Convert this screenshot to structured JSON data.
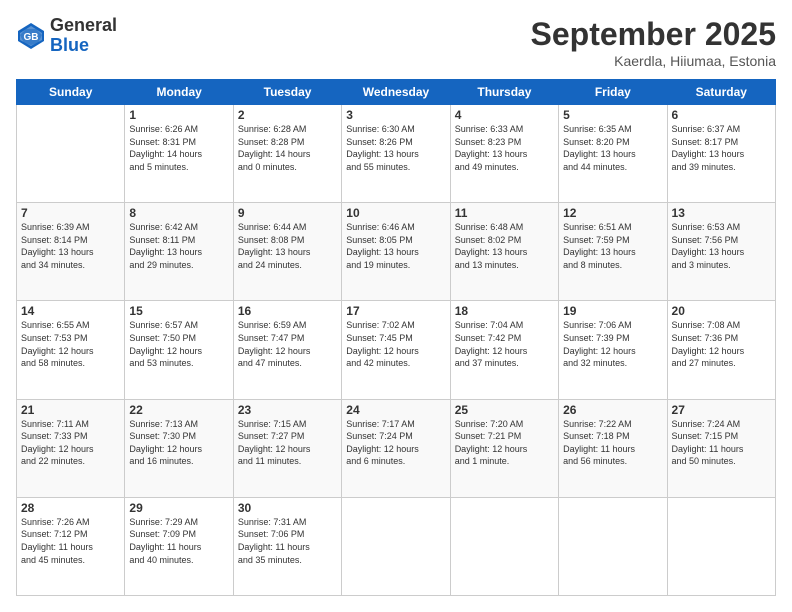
{
  "logo": {
    "general": "General",
    "blue": "Blue"
  },
  "header": {
    "month": "September 2025",
    "location": "Kaerdla, Hiiumaa, Estonia"
  },
  "weekdays": [
    "Sunday",
    "Monday",
    "Tuesday",
    "Wednesday",
    "Thursday",
    "Friday",
    "Saturday"
  ],
  "weeks": [
    [
      {
        "day": "",
        "info": ""
      },
      {
        "day": "1",
        "info": "Sunrise: 6:26 AM\nSunset: 8:31 PM\nDaylight: 14 hours\nand 5 minutes."
      },
      {
        "day": "2",
        "info": "Sunrise: 6:28 AM\nSunset: 8:28 PM\nDaylight: 14 hours\nand 0 minutes."
      },
      {
        "day": "3",
        "info": "Sunrise: 6:30 AM\nSunset: 8:26 PM\nDaylight: 13 hours\nand 55 minutes."
      },
      {
        "day": "4",
        "info": "Sunrise: 6:33 AM\nSunset: 8:23 PM\nDaylight: 13 hours\nand 49 minutes."
      },
      {
        "day": "5",
        "info": "Sunrise: 6:35 AM\nSunset: 8:20 PM\nDaylight: 13 hours\nand 44 minutes."
      },
      {
        "day": "6",
        "info": "Sunrise: 6:37 AM\nSunset: 8:17 PM\nDaylight: 13 hours\nand 39 minutes."
      }
    ],
    [
      {
        "day": "7",
        "info": "Sunrise: 6:39 AM\nSunset: 8:14 PM\nDaylight: 13 hours\nand 34 minutes."
      },
      {
        "day": "8",
        "info": "Sunrise: 6:42 AM\nSunset: 8:11 PM\nDaylight: 13 hours\nand 29 minutes."
      },
      {
        "day": "9",
        "info": "Sunrise: 6:44 AM\nSunset: 8:08 PM\nDaylight: 13 hours\nand 24 minutes."
      },
      {
        "day": "10",
        "info": "Sunrise: 6:46 AM\nSunset: 8:05 PM\nDaylight: 13 hours\nand 19 minutes."
      },
      {
        "day": "11",
        "info": "Sunrise: 6:48 AM\nSunset: 8:02 PM\nDaylight: 13 hours\nand 13 minutes."
      },
      {
        "day": "12",
        "info": "Sunrise: 6:51 AM\nSunset: 7:59 PM\nDaylight: 13 hours\nand 8 minutes."
      },
      {
        "day": "13",
        "info": "Sunrise: 6:53 AM\nSunset: 7:56 PM\nDaylight: 13 hours\nand 3 minutes."
      }
    ],
    [
      {
        "day": "14",
        "info": "Sunrise: 6:55 AM\nSunset: 7:53 PM\nDaylight: 12 hours\nand 58 minutes."
      },
      {
        "day": "15",
        "info": "Sunrise: 6:57 AM\nSunset: 7:50 PM\nDaylight: 12 hours\nand 53 minutes."
      },
      {
        "day": "16",
        "info": "Sunrise: 6:59 AM\nSunset: 7:47 PM\nDaylight: 12 hours\nand 47 minutes."
      },
      {
        "day": "17",
        "info": "Sunrise: 7:02 AM\nSunset: 7:45 PM\nDaylight: 12 hours\nand 42 minutes."
      },
      {
        "day": "18",
        "info": "Sunrise: 7:04 AM\nSunset: 7:42 PM\nDaylight: 12 hours\nand 37 minutes."
      },
      {
        "day": "19",
        "info": "Sunrise: 7:06 AM\nSunset: 7:39 PM\nDaylight: 12 hours\nand 32 minutes."
      },
      {
        "day": "20",
        "info": "Sunrise: 7:08 AM\nSunset: 7:36 PM\nDaylight: 12 hours\nand 27 minutes."
      }
    ],
    [
      {
        "day": "21",
        "info": "Sunrise: 7:11 AM\nSunset: 7:33 PM\nDaylight: 12 hours\nand 22 minutes."
      },
      {
        "day": "22",
        "info": "Sunrise: 7:13 AM\nSunset: 7:30 PM\nDaylight: 12 hours\nand 16 minutes."
      },
      {
        "day": "23",
        "info": "Sunrise: 7:15 AM\nSunset: 7:27 PM\nDaylight: 12 hours\nand 11 minutes."
      },
      {
        "day": "24",
        "info": "Sunrise: 7:17 AM\nSunset: 7:24 PM\nDaylight: 12 hours\nand 6 minutes."
      },
      {
        "day": "25",
        "info": "Sunrise: 7:20 AM\nSunset: 7:21 PM\nDaylight: 12 hours\nand 1 minute."
      },
      {
        "day": "26",
        "info": "Sunrise: 7:22 AM\nSunset: 7:18 PM\nDaylight: 11 hours\nand 56 minutes."
      },
      {
        "day": "27",
        "info": "Sunrise: 7:24 AM\nSunset: 7:15 PM\nDaylight: 11 hours\nand 50 minutes."
      }
    ],
    [
      {
        "day": "28",
        "info": "Sunrise: 7:26 AM\nSunset: 7:12 PM\nDaylight: 11 hours\nand 45 minutes."
      },
      {
        "day": "29",
        "info": "Sunrise: 7:29 AM\nSunset: 7:09 PM\nDaylight: 11 hours\nand 40 minutes."
      },
      {
        "day": "30",
        "info": "Sunrise: 7:31 AM\nSunset: 7:06 PM\nDaylight: 11 hours\nand 35 minutes."
      },
      {
        "day": "",
        "info": ""
      },
      {
        "day": "",
        "info": ""
      },
      {
        "day": "",
        "info": ""
      },
      {
        "day": "",
        "info": ""
      }
    ]
  ]
}
